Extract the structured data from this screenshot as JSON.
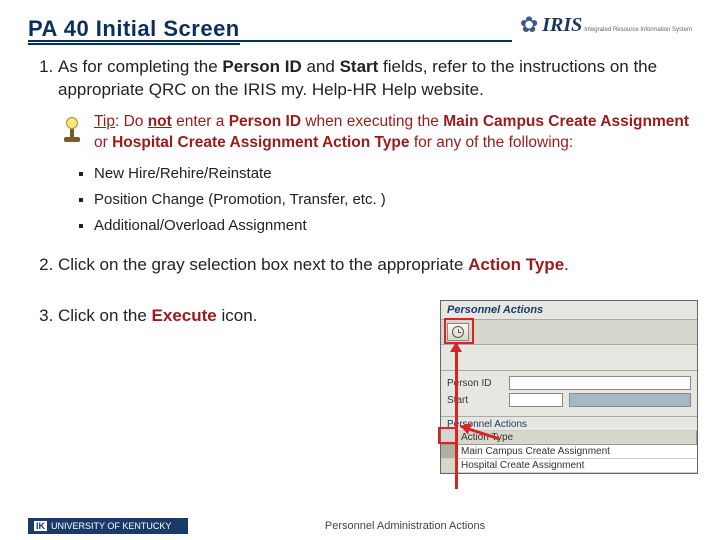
{
  "header": {
    "title": "PA 40 Initial Screen",
    "logo_text": "IRIS",
    "logo_sub": "Integrated Resource\nInformation System"
  },
  "steps": {
    "s1_a": "As for completing the ",
    "s1_b": "Person ID",
    "s1_c": " and ",
    "s1_d": "Start",
    "s1_e": " fields, refer to the instructions on the appropriate QRC on the IRIS my. Help-HR Help website.",
    "tip_label": "Tip",
    "tip_a": ":  Do ",
    "tip_not": "not",
    "tip_b": " enter a ",
    "tip_c": "Person ID",
    "tip_d": " when executing the ",
    "tip_e": "Main Campus Create Assignment",
    "tip_f": " or ",
    "tip_g": "Hospital Create Assignment Action Type",
    "tip_h": " for any of the following:",
    "bullets": [
      "New Hire/Rehire/Reinstate",
      "Position Change (Promotion, Transfer, etc. )",
      "Additional/Overload Assignment"
    ],
    "s2_a": "Click on the gray selection box next to the appropriate ",
    "s2_b": "Action Type",
    "s2_c": ".",
    "s3_a": "Click on the ",
    "s3_b": "Execute",
    "s3_c": " icon."
  },
  "screenshot": {
    "title": "Personnel Actions",
    "label_person": "Person ID",
    "label_start": "Start",
    "group": "Personnel Actions",
    "col_action": "Action Type",
    "row1": "Main Campus Create Assignment",
    "row2": "Hospital Create Assignment"
  },
  "footer": {
    "uk": "UNIVERSITY OF KENTUCKY",
    "caption": "Personnel Administration Actions"
  }
}
